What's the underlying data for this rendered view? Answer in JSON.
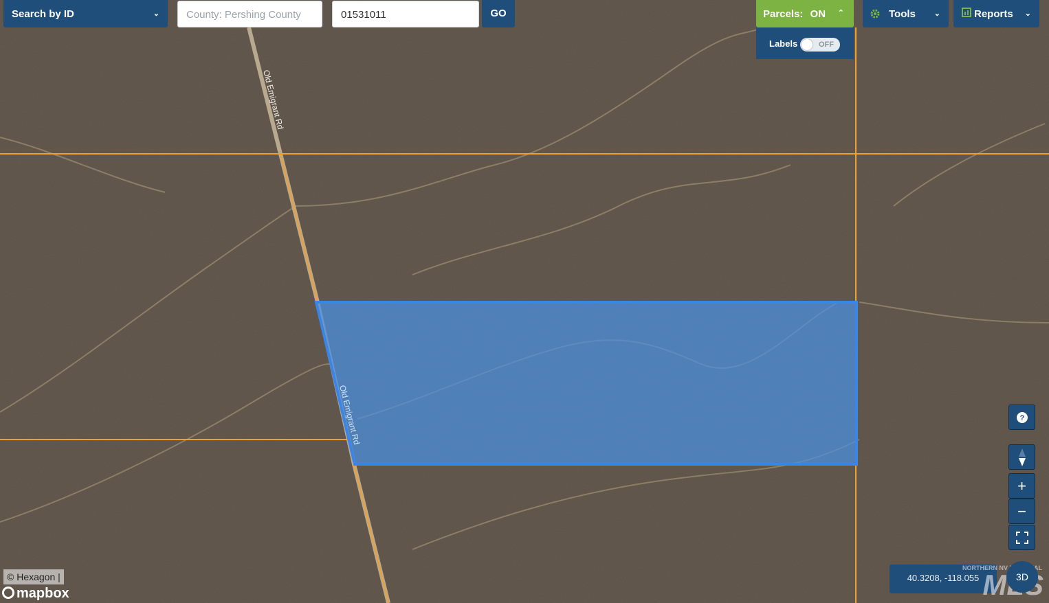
{
  "toolbar": {
    "search_mode": "Search by ID",
    "county_placeholder": "County: Pershing County",
    "parcel_id_value": "01531011",
    "go_label": "GO",
    "parcels_label": "Parcels:",
    "parcels_state": "ON",
    "labels_label": "Labels",
    "labels_state": "OFF",
    "tools_label": "Tools",
    "reports_label": "Reports"
  },
  "map": {
    "road_label_north": "Old Emigrant Rd",
    "road_label_south": "Old Emigrant Rd",
    "parcel_color": "#4a90e2",
    "parcel_line_color": "#f0a030",
    "coordinates": "40.3208, -118.055",
    "view_3d_label": "3D",
    "attribution": "© Hexagon |",
    "provider": "mapbox",
    "watermark_small": "NORTHERN NV REGIONAL",
    "watermark_large": "MLS"
  },
  "controls": {
    "help_icon": "question-icon",
    "compass_icon": "compass-icon",
    "zoom_in": "+",
    "zoom_out": "−",
    "fullscreen_icon": "fullscreen-icon"
  }
}
